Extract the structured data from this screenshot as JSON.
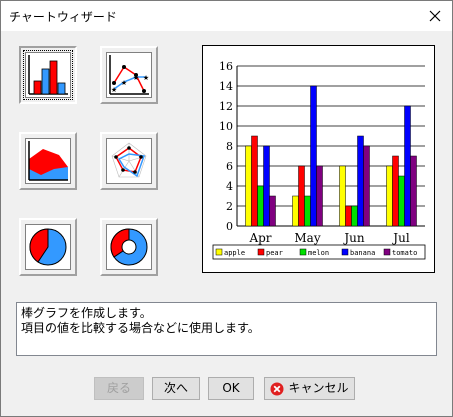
{
  "window": {
    "title": "チャートウィザード"
  },
  "chart_types": [
    {
      "name": "bar",
      "selected": true
    },
    {
      "name": "line",
      "selected": false
    },
    {
      "name": "area",
      "selected": false
    },
    {
      "name": "radar",
      "selected": false
    },
    {
      "name": "pie",
      "selected": false
    },
    {
      "name": "doughnut",
      "selected": false
    }
  ],
  "description": {
    "line1": "棒グラフを作成します。",
    "line2": "項目の値を比較する場合などに使用します。"
  },
  "buttons": {
    "back": "戻る",
    "next": "次へ",
    "ok": "OK",
    "cancel": "キャンセル"
  },
  "colors": {
    "apple": "#ffff00",
    "pear": "#ff0000",
    "melon": "#00e000",
    "banana": "#0000ff",
    "tomato": "#800080"
  },
  "chart_data": {
    "type": "bar",
    "categories": [
      "Apr",
      "May",
      "Jun",
      "Jul"
    ],
    "series": [
      {
        "name": "apple",
        "values": [
          8,
          3,
          6,
          6
        ]
      },
      {
        "name": "pear",
        "values": [
          9,
          6,
          2,
          7
        ]
      },
      {
        "name": "melon",
        "values": [
          4,
          3,
          2,
          5
        ]
      },
      {
        "name": "banana",
        "values": [
          8,
          14,
          9,
          12
        ]
      },
      {
        "name": "tomato",
        "values": [
          3,
          6,
          8,
          7
        ]
      }
    ],
    "yticks": [
      "0",
      "2",
      "4",
      "6",
      "8",
      "10",
      "12",
      "14",
      "16"
    ],
    "ylim": [
      0,
      16
    ],
    "legend": "bottom",
    "grid": true
  }
}
